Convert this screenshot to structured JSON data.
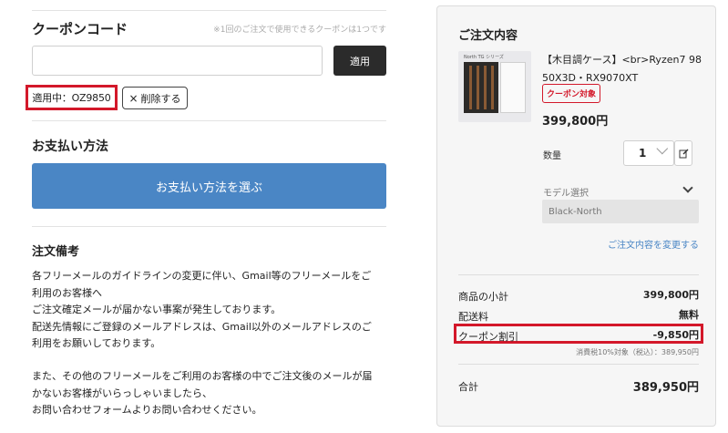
{
  "coupon": {
    "title": "クーポンコード",
    "note": "※1回のご注文で使用できるクーポンは1つです",
    "input_value": "",
    "input_placeholder": "",
    "apply_label": "適用",
    "applied_label": "適用中：OZ9850",
    "remove_label": "削除する",
    "remove_icon": "×"
  },
  "payment": {
    "title": "お支払い方法",
    "button_label": "お支払い方法を選ぶ"
  },
  "notes": {
    "title": "注文備考",
    "lines": [
      "各フリーメールのガイドラインの変更に伴い、Gmail等のフリーメールをご",
      "利用のお客様へ",
      "ご注文確定メールが届かない事案が発生しております。",
      "配送先情報にご登録のメールアドレスは、Gmail以外のメールアドレスのご",
      "利用をお願いしております。",
      "また、その他のフリーメールをご利用のお客様の中でご注文後のメールが届",
      "かないお客様がいらっしゃいましたら、",
      "お問い合わせフォームよりお問い合わせください。"
    ]
  },
  "summary": {
    "title": "ご注文内容",
    "product": {
      "thumb_label": "North TG シリーズ",
      "name": "【木目調ケース】<br>Ryzen7 9850X3D・RX9070XT",
      "badge": "クーポン対象",
      "price": "399,800円",
      "qty_label": "数量",
      "qty_value": "1",
      "model_label": "モデル選択",
      "model_value": "Black-North"
    },
    "change_link": "ご注文内容を変更する",
    "subtotal_label": "商品の小計",
    "subtotal_value": "399,800円",
    "shipping_label": "配送料",
    "shipping_value": "無料",
    "discount_label": "クーポン割引",
    "discount_value": "-9,850円",
    "tax_note": "消費税10%対象（税込）：389,950円",
    "total_label": "合計",
    "total_value": "389,950円"
  },
  "colors": {
    "accent_blue": "#4a86c5",
    "highlight_red": "#d3182a",
    "apply_button": "#2b2b2b",
    "panel_bg": "#f6f6f6"
  }
}
